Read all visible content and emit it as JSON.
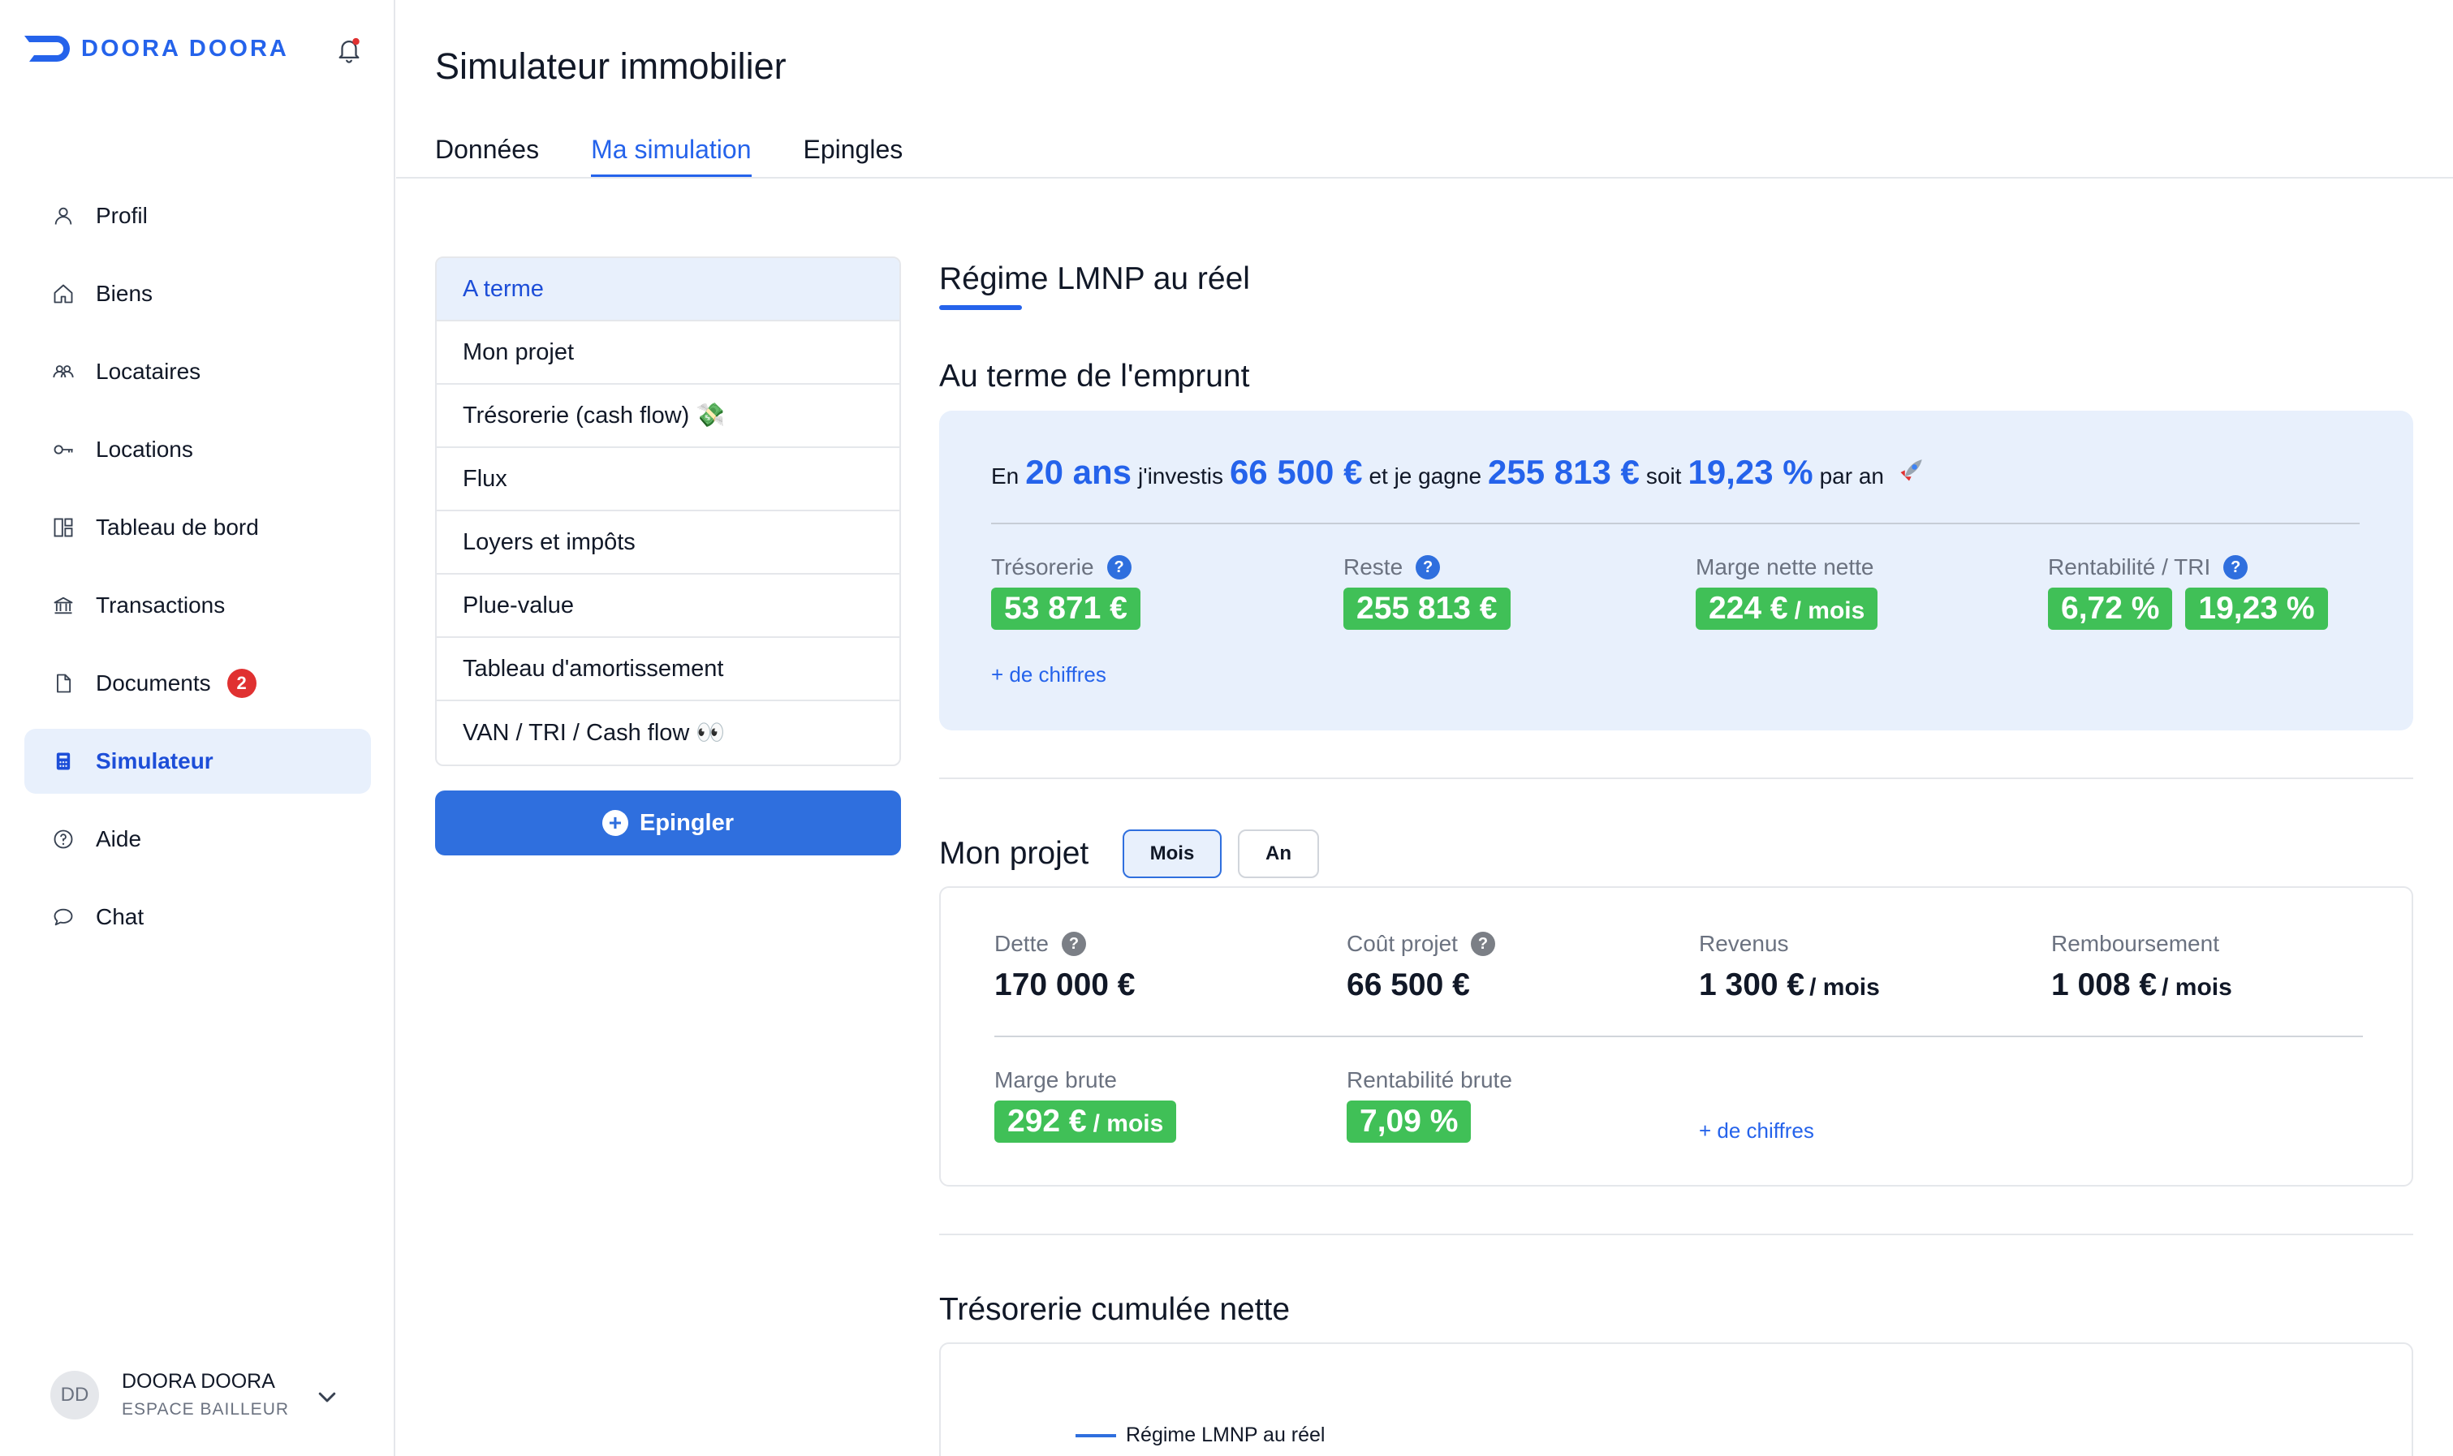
{
  "app": {
    "brand": "DOORA DOORA",
    "colors": {
      "accent": "#2563eb",
      "positive": "#40c057",
      "badge": "#e03131",
      "active_bg": "#e8f0fc"
    }
  },
  "sidebar": {
    "items": [
      {
        "label": "Profil",
        "icon": "user-icon"
      },
      {
        "label": "Biens",
        "icon": "home-icon"
      },
      {
        "label": "Locataires",
        "icon": "users-icon"
      },
      {
        "label": "Locations",
        "icon": "key-icon"
      },
      {
        "label": "Tableau de bord",
        "icon": "dashboard-icon"
      },
      {
        "label": "Transactions",
        "icon": "bank-icon"
      },
      {
        "label": "Documents",
        "icon": "file-icon",
        "badge": "2"
      },
      {
        "label": "Simulateur",
        "icon": "calculator-icon",
        "active": true
      },
      {
        "label": "Aide",
        "icon": "help-icon"
      },
      {
        "label": "Chat",
        "icon": "chat-icon"
      }
    ],
    "user": {
      "initials": "DD",
      "name": "DOORA DOORA",
      "role": "ESPACE BAILLEUR"
    }
  },
  "header": {
    "title": "Simulateur immobilier",
    "tabs": [
      {
        "label": "Données"
      },
      {
        "label": "Ma simulation",
        "active": true
      },
      {
        "label": "Epingles"
      }
    ]
  },
  "submenu": {
    "items": [
      {
        "label": "A terme",
        "active": true
      },
      {
        "label": "Mon projet"
      },
      {
        "label": "Trésorerie (cash flow) 💸"
      },
      {
        "label": "Flux"
      },
      {
        "label": "Loyers et impôts"
      },
      {
        "label": "Plue-value"
      },
      {
        "label": "Tableau d'amortissement"
      },
      {
        "label": "VAN / TRI / Cash flow 👀"
      }
    ],
    "pin_button": "Epingler"
  },
  "main": {
    "regime_title": "Régime LMNP au réel",
    "term": {
      "title": "Au terme de l'emprunt",
      "sentence": {
        "p1": "En",
        "v1": "20 ans",
        "p2": "j'investis",
        "v2": "66 500 €",
        "p3": "et je gagne",
        "v3": "255 813 €",
        "p4": "soit",
        "v4": "19,23 %",
        "p5": "par an"
      },
      "kpis": {
        "tresorerie": {
          "label": "Trésorerie",
          "value": "53 871 €"
        },
        "reste": {
          "label": "Reste",
          "value": "255 813 €"
        },
        "marge": {
          "label": "Marge nette nette",
          "value": "224 €",
          "unit": "/ mois"
        },
        "rentabilite": {
          "label": "Rentabilité / TRI",
          "value1": "6,72 %",
          "value2": "19,23 %"
        }
      },
      "more": "+ de chiffres"
    },
    "project": {
      "title": "Mon projet",
      "toggle": {
        "month": "Mois",
        "year": "An",
        "selected": "Mois"
      },
      "dette": {
        "label": "Dette",
        "value": "170 000 €"
      },
      "cout": {
        "label": "Coût projet",
        "value": "66 500 €"
      },
      "revenus": {
        "label": "Revenus",
        "value": "1 300 €",
        "unit": "/ mois"
      },
      "remboursement": {
        "label": "Remboursement",
        "value": "1 008 €",
        "unit": "/ mois"
      },
      "marge_brute": {
        "label": "Marge brute",
        "value": "292 €",
        "unit": "/ mois"
      },
      "rentabilite_brute": {
        "label": "Rentabilité brute",
        "value": "7,09 %"
      },
      "more": "+ de chiffres"
    },
    "cashflow": {
      "title": "Trésorerie cumulée nette",
      "legend": "Régime LMNP au réel"
    }
  }
}
